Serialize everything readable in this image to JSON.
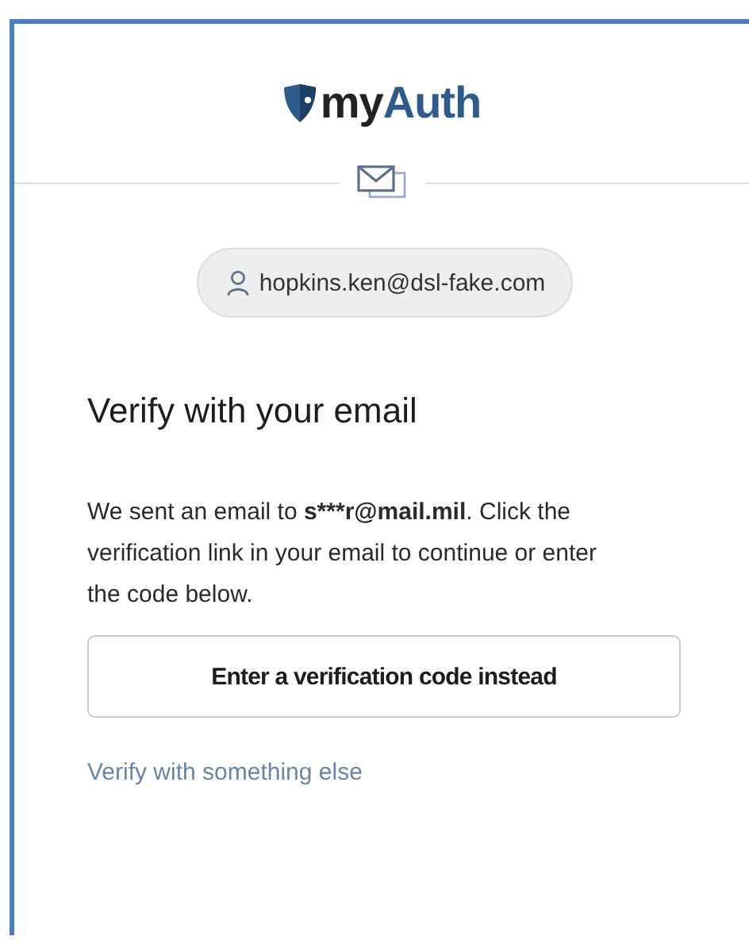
{
  "logo": {
    "parts": [
      "my",
      "Auth"
    ]
  },
  "account": {
    "email": "hopkins.ken@dsl-fake.com"
  },
  "heading": "Verify with your email",
  "message": {
    "before": "We sent an email to ",
    "address": "s***r@mail.mil",
    "after": ". Click the verification link in your email to continue or enter the code below."
  },
  "primary_button": "Enter a verification code instead",
  "alt_link": "Verify with something else"
}
